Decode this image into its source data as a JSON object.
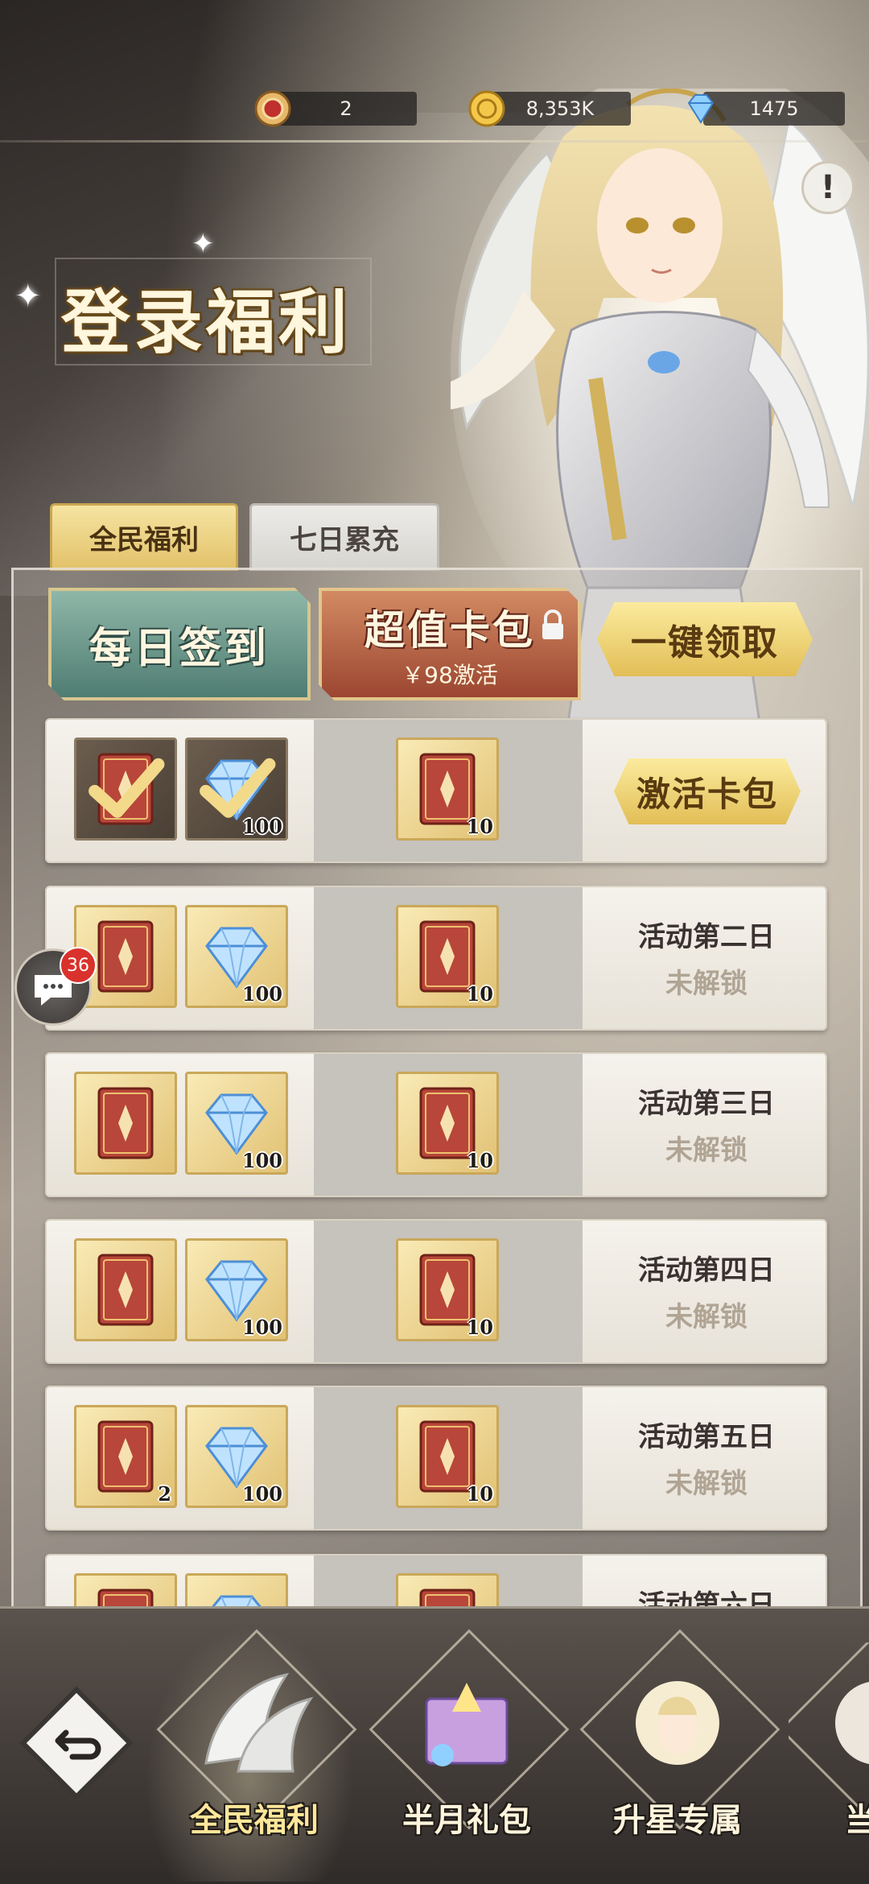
{
  "currencies": [
    {
      "icon": "medal-coin-icon",
      "value": "2"
    },
    {
      "icon": "gold-coin-icon",
      "value": "8,353K"
    },
    {
      "icon": "diamond-icon",
      "value": "1475"
    }
  ],
  "info_button": "!",
  "page_title": "登录福利",
  "tabs": {
    "active": "全民福利",
    "inactive": "七日累充"
  },
  "actions": {
    "daily_checkin": "每日签到",
    "value_pack": {
      "title": "超值卡包",
      "price": "￥98激活"
    },
    "claim_all": "一键领取"
  },
  "rows": [
    {
      "items": [
        {
          "icon": "card-pack-icon",
          "qty": "",
          "claimed": true
        },
        {
          "icon": "diamond-icon",
          "qty": "100",
          "claimed": true
        }
      ],
      "premium": {
        "icon": "card-pack-icon",
        "qty": "10"
      },
      "action": "激活卡包"
    },
    {
      "items": [
        {
          "icon": "card-pack-icon",
          "qty": ""
        },
        {
          "icon": "diamond-icon",
          "qty": "100"
        }
      ],
      "premium": {
        "icon": "card-pack-icon",
        "qty": "10"
      },
      "day": "活动第二日",
      "status": "未解锁"
    },
    {
      "items": [
        {
          "icon": "card-pack-icon",
          "qty": ""
        },
        {
          "icon": "diamond-icon",
          "qty": "100"
        }
      ],
      "premium": {
        "icon": "card-pack-icon",
        "qty": "10"
      },
      "day": "活动第三日",
      "status": "未解锁"
    },
    {
      "items": [
        {
          "icon": "card-pack-icon",
          "qty": ""
        },
        {
          "icon": "diamond-icon",
          "qty": "100"
        }
      ],
      "premium": {
        "icon": "card-pack-icon",
        "qty": "10"
      },
      "day": "活动第四日",
      "status": "未解锁"
    },
    {
      "items": [
        {
          "icon": "card-pack-icon",
          "qty": "2"
        },
        {
          "icon": "diamond-icon",
          "qty": "100"
        }
      ],
      "premium": {
        "icon": "card-pack-icon",
        "qty": "10"
      },
      "day": "活动第五日",
      "status": "未解锁"
    },
    {
      "items": [
        {
          "icon": "card-pack-icon",
          "qty": ""
        },
        {
          "icon": "diamond-icon",
          "qty": ""
        }
      ],
      "premium": {
        "icon": "card-pack-icon",
        "qty": ""
      },
      "day": "活动第六日",
      "status": ""
    }
  ],
  "chat_badge": "36",
  "bottom_nav": [
    {
      "label": "全民福利",
      "active": true
    },
    {
      "label": "半月礼包"
    },
    {
      "label": "升星专属"
    },
    {
      "label": "当季"
    }
  ],
  "colors": {
    "gold_accent": "#e2be56",
    "green_button": "#4f7c72",
    "red_button": "#9c4631",
    "badge_red": "#d9322c"
  }
}
